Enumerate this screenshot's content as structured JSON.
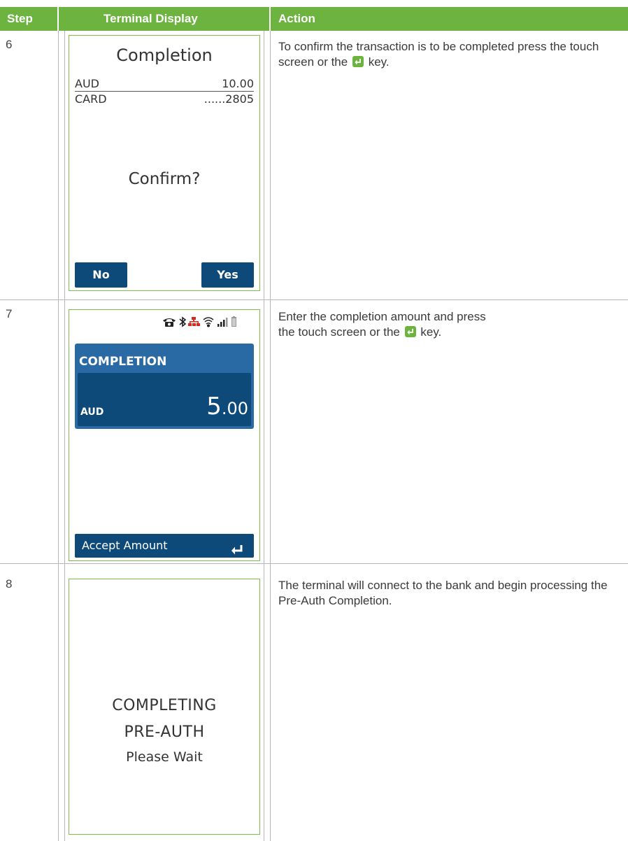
{
  "header": {
    "step": "Step",
    "terminal": "Terminal Display",
    "action": "Action"
  },
  "colors": {
    "accent": "#6cb33f",
    "button": "#0d4a7a",
    "panel": "#2a6aa4",
    "border": "#7bc04a"
  },
  "rows": [
    {
      "step": "6",
      "screen": {
        "title": "Completion",
        "currency_label": "AUD",
        "amount": "10.00",
        "card_label": "CARD",
        "card_value": "......2805",
        "prompt": "Confirm?",
        "no_label": "No",
        "yes_label": "Yes"
      },
      "action_pre": "To confirm the transaction is to be completed press the touch screen or the",
      "action_post": "key.",
      "action_icon": "enter-key-icon"
    },
    {
      "step": "7",
      "screen": {
        "status_icons": [
          "phone-icon",
          "bluetooth-icon",
          "network-icon",
          "wifi-icon",
          "signal-icon",
          "battery-icon"
        ],
        "panel_title": "COMPLETION",
        "currency": "AUD",
        "amount_major": "5",
        "amount_minor": ".00",
        "accept_label": "Accept Amount",
        "accept_icon": "enter-arrow-icon"
      },
      "action_line1": "Enter the completion amount and press",
      "action_pre": "the touch screen or the",
      "action_post": "key.",
      "action_icon": "enter-key-icon"
    },
    {
      "step": "8",
      "screen": {
        "line1": "COMPLETING",
        "line2": "PRE-AUTH",
        "line3": "Please Wait"
      },
      "action": "The terminal will connect to the bank and begin processing the Pre-Auth Completion."
    }
  ]
}
